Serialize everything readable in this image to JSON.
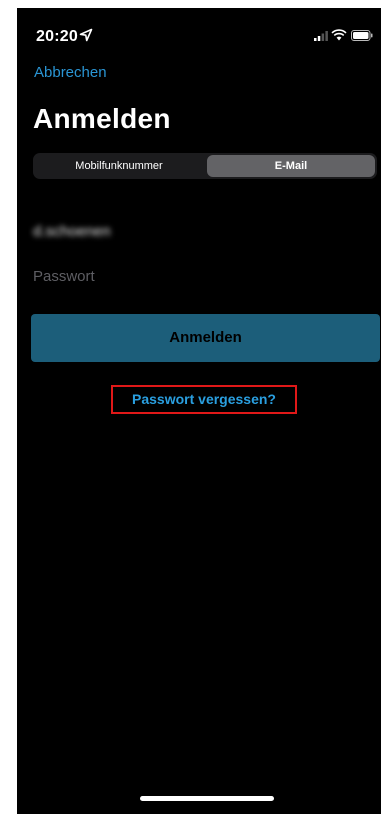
{
  "status_bar": {
    "time": "20:20"
  },
  "nav": {
    "cancel_label": "Abbrechen"
  },
  "page": {
    "title": "Anmelden"
  },
  "segments": {
    "left_label": "Mobilfunknummer",
    "right_label": "E-Mail",
    "selected": "E-Mail"
  },
  "form": {
    "email_value": "d.schoenen",
    "password_placeholder": "Passwort",
    "submit_label": "Anmelden",
    "forgot_label": "Passwort vergessen?"
  },
  "colors": {
    "accent": "#2a95d4",
    "button_bg": "#1c5e7a",
    "highlight_border": "#e01818",
    "background": "#000000"
  },
  "icons": [
    "location-arrow-icon",
    "signal-icon",
    "wifi-icon",
    "battery-icon"
  ]
}
